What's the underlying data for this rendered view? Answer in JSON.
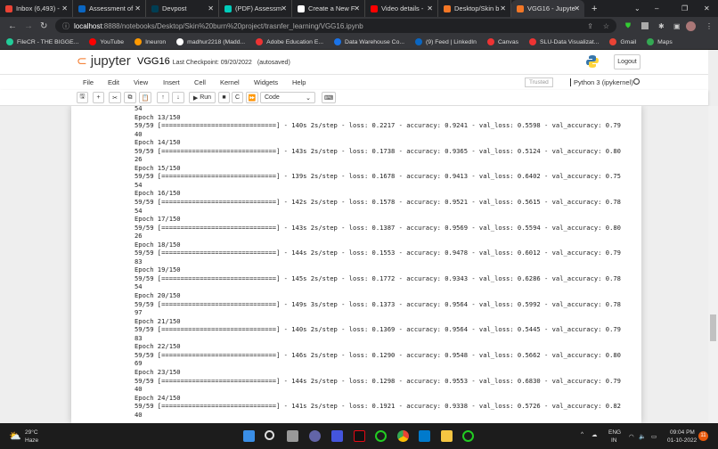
{
  "browser": {
    "tabs": [
      {
        "label": "Inbox (6,493) -",
        "color": "#ea4335"
      },
      {
        "label": "Assessment of",
        "color": "#0a66c2"
      },
      {
        "label": "Devpost",
        "color": "#003e54"
      },
      {
        "label": "(PDF) Assessm",
        "color": "#00ccbb"
      },
      {
        "label": "Create a New F",
        "color": "#ffffff"
      },
      {
        "label": "Video details -",
        "color": "#ff0000"
      },
      {
        "label": "Desktop/Skin b",
        "color": "#f37726"
      },
      {
        "label": "VGG16 - Jupyte",
        "color": "#f37726",
        "active": true
      }
    ],
    "new_tab": "+",
    "url_host": "localhost",
    "url_path": ":8888/notebooks/Desktop/Skin%20burn%20project/trasnfer_learning/VGG16.ipynb",
    "bookmarks": [
      "FileCR - THE BIGGE...",
      "YouTube",
      "Ineuron",
      "madhur2218 (Madd...",
      "Adobe Education E...",
      "Data Warehouse Co...",
      "(9) Feed | LinkedIn",
      "Canvas",
      "SLU-Data Visualizat...",
      "Gmail",
      "Maps"
    ]
  },
  "jupyter": {
    "logo": "jupyter",
    "notebook_name": "VGG16",
    "checkpoint": "Last Checkpoint: 09/20/2022",
    "autosaved": "(autosaved)",
    "logout": "Logout",
    "menu": [
      "File",
      "Edit",
      "View",
      "Insert",
      "Cell",
      "Kernel",
      "Widgets",
      "Help"
    ],
    "trusted": "Trusted",
    "kernel": "Python 3 (ipykernel)",
    "run": "Run",
    "cell_type": "Code"
  },
  "output_lines": [
    "54",
    "Epoch 13/150",
    "59/59 [==============================] - 140s 2s/step - loss: 0.2217 - accuracy: 0.9241 - val_loss: 0.5598 - val_accuracy: 0.79",
    "40",
    "Epoch 14/150",
    "59/59 [==============================] - 143s 2s/step - loss: 0.1738 - accuracy: 0.9365 - val_loss: 0.5124 - val_accuracy: 0.80",
    "26",
    "Epoch 15/150",
    "59/59 [==============================] - 139s 2s/step - loss: 0.1678 - accuracy: 0.9413 - val_loss: 0.6402 - val_accuracy: 0.75",
    "54",
    "Epoch 16/150",
    "59/59 [==============================] - 142s 2s/step - loss: 0.1578 - accuracy: 0.9521 - val_loss: 0.5615 - val_accuracy: 0.78",
    "54",
    "Epoch 17/150",
    "59/59 [==============================] - 143s 2s/step - loss: 0.1387 - accuracy: 0.9569 - val_loss: 0.5594 - val_accuracy: 0.80",
    "26",
    "Epoch 18/150",
    "59/59 [==============================] - 144s 2s/step - loss: 0.1553 - accuracy: 0.9478 - val_loss: 0.6012 - val_accuracy: 0.79",
    "83",
    "Epoch 19/150",
    "59/59 [==============================] - 145s 2s/step - loss: 0.1772 - accuracy: 0.9343 - val_loss: 0.6286 - val_accuracy: 0.78",
    "54",
    "Epoch 20/150",
    "59/59 [==============================] - 149s 3s/step - loss: 0.1373 - accuracy: 0.9564 - val_loss: 0.5992 - val_accuracy: 0.78",
    "97",
    "Epoch 21/150",
    "59/59 [==============================] - 140s 2s/step - loss: 0.1369 - accuracy: 0.9564 - val_loss: 0.5445 - val_accuracy: 0.79",
    "83",
    "Epoch 22/150",
    "59/59 [==============================] - 146s 2s/step - loss: 0.1290 - accuracy: 0.9548 - val_loss: 0.5662 - val_accuracy: 0.80",
    "69",
    "Epoch 23/150",
    "59/59 [==============================] - 144s 2s/step - loss: 0.1298 - accuracy: 0.9553 - val_loss: 0.6830 - val_accuracy: 0.79",
    "40",
    "Epoch 24/150",
    "59/59 [==============================] - 141s 2s/step - loss: 0.1921 - accuracy: 0.9338 - val_loss: 0.5726 - val_accuracy: 0.82",
    "40"
  ],
  "taskbar": {
    "temp": "29°C",
    "weather": "Haze",
    "lang1": "ENG",
    "lang2": "IN",
    "time": "09:04 PM",
    "date": "01-10-2022",
    "badge": "11"
  }
}
